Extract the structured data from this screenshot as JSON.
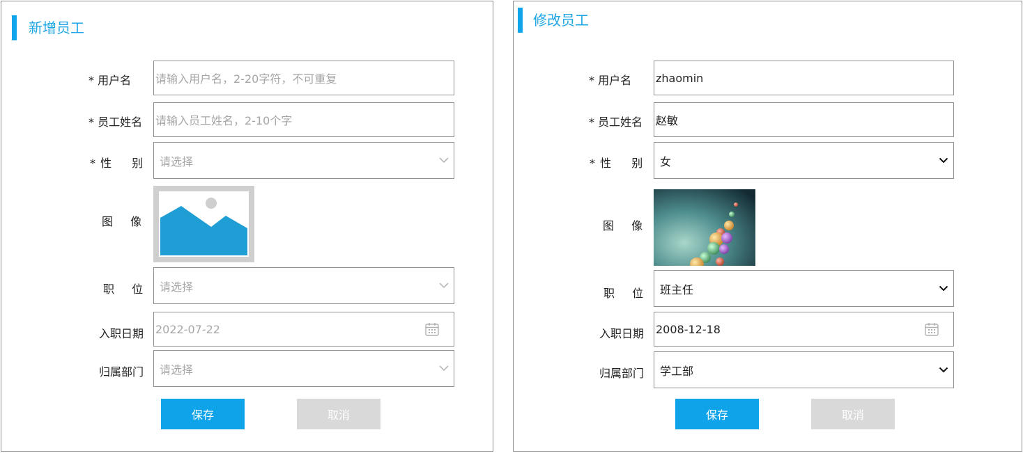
{
  "add_form": {
    "title": "新增员工",
    "username": {
      "label": "* 用户名",
      "placeholder": "请输入用户名，2-20字符，不可重复",
      "value": ""
    },
    "name": {
      "label": "* 员工姓名",
      "placeholder": "请输入员工姓名，2-10个字",
      "value": ""
    },
    "gender": {
      "label_mark": "*",
      "label_a": "性",
      "label_b": "别",
      "placeholder": "请选择"
    },
    "avatar": {
      "label_a": "图",
      "label_b": "像",
      "icon": "image-placeholder-icon"
    },
    "position": {
      "label_a": "职",
      "label_b": "位",
      "placeholder": "请选择"
    },
    "hire_date": {
      "label": "入职日期",
      "value": "2022-07-22"
    },
    "department": {
      "label": "归属部门",
      "placeholder": "请选择"
    },
    "save_label": "保存",
    "cancel_label": "取消"
  },
  "edit_form": {
    "title": "修改员工",
    "username": {
      "label": "* 用户名",
      "value": "zhaomin"
    },
    "name": {
      "label": "* 员工姓名",
      "value": "赵敏"
    },
    "gender": {
      "label_mark": "*",
      "label_a": "性",
      "label_b": "别",
      "value": "女"
    },
    "avatar": {
      "label_a": "图",
      "label_b": "像",
      "image": "balloons-photo"
    },
    "position": {
      "label_a": "职",
      "label_b": "位",
      "value": "班主任"
    },
    "hire_date": {
      "label": "入职日期",
      "value": "2008-12-18"
    },
    "department": {
      "label": "归属部门",
      "value": "学工部"
    },
    "save_label": "保存",
    "cancel_label": "取消"
  },
  "colors": {
    "accent": "#0fa3ea",
    "cancel_bg": "#d9d9d9",
    "border": "#8f8f8f",
    "placeholder": "#a6a6a6",
    "avatar_placeholder_blue": "#1f9ed6",
    "avatar_placeholder_frame": "#cfcfcf"
  }
}
